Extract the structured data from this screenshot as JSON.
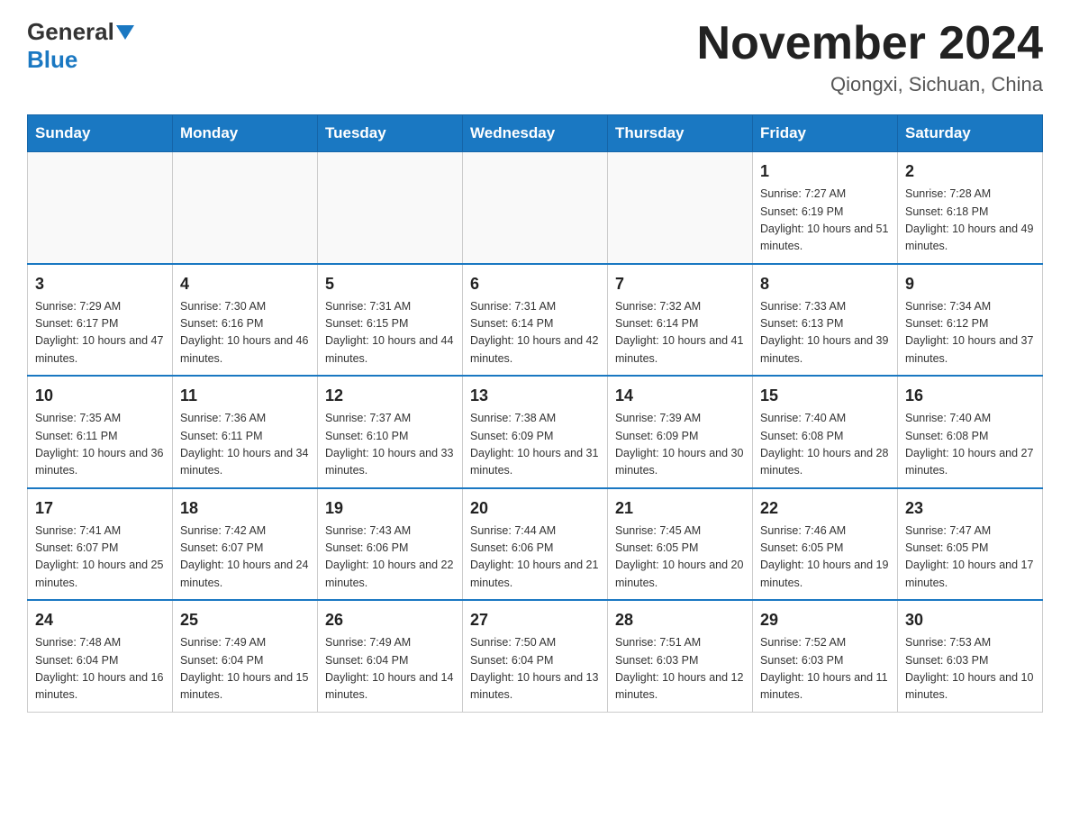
{
  "header": {
    "logo_general": "General",
    "logo_blue": "Blue",
    "month_title": "November 2024",
    "location": "Qiongxi, Sichuan, China"
  },
  "days_of_week": [
    "Sunday",
    "Monday",
    "Tuesday",
    "Wednesday",
    "Thursday",
    "Friday",
    "Saturday"
  ],
  "weeks": [
    [
      {
        "day": "",
        "info": ""
      },
      {
        "day": "",
        "info": ""
      },
      {
        "day": "",
        "info": ""
      },
      {
        "day": "",
        "info": ""
      },
      {
        "day": "",
        "info": ""
      },
      {
        "day": "1",
        "info": "Sunrise: 7:27 AM\nSunset: 6:19 PM\nDaylight: 10 hours and 51 minutes."
      },
      {
        "day": "2",
        "info": "Sunrise: 7:28 AM\nSunset: 6:18 PM\nDaylight: 10 hours and 49 minutes."
      }
    ],
    [
      {
        "day": "3",
        "info": "Sunrise: 7:29 AM\nSunset: 6:17 PM\nDaylight: 10 hours and 47 minutes."
      },
      {
        "day": "4",
        "info": "Sunrise: 7:30 AM\nSunset: 6:16 PM\nDaylight: 10 hours and 46 minutes."
      },
      {
        "day": "5",
        "info": "Sunrise: 7:31 AM\nSunset: 6:15 PM\nDaylight: 10 hours and 44 minutes."
      },
      {
        "day": "6",
        "info": "Sunrise: 7:31 AM\nSunset: 6:14 PM\nDaylight: 10 hours and 42 minutes."
      },
      {
        "day": "7",
        "info": "Sunrise: 7:32 AM\nSunset: 6:14 PM\nDaylight: 10 hours and 41 minutes."
      },
      {
        "day": "8",
        "info": "Sunrise: 7:33 AM\nSunset: 6:13 PM\nDaylight: 10 hours and 39 minutes."
      },
      {
        "day": "9",
        "info": "Sunrise: 7:34 AM\nSunset: 6:12 PM\nDaylight: 10 hours and 37 minutes."
      }
    ],
    [
      {
        "day": "10",
        "info": "Sunrise: 7:35 AM\nSunset: 6:11 PM\nDaylight: 10 hours and 36 minutes."
      },
      {
        "day": "11",
        "info": "Sunrise: 7:36 AM\nSunset: 6:11 PM\nDaylight: 10 hours and 34 minutes."
      },
      {
        "day": "12",
        "info": "Sunrise: 7:37 AM\nSunset: 6:10 PM\nDaylight: 10 hours and 33 minutes."
      },
      {
        "day": "13",
        "info": "Sunrise: 7:38 AM\nSunset: 6:09 PM\nDaylight: 10 hours and 31 minutes."
      },
      {
        "day": "14",
        "info": "Sunrise: 7:39 AM\nSunset: 6:09 PM\nDaylight: 10 hours and 30 minutes."
      },
      {
        "day": "15",
        "info": "Sunrise: 7:40 AM\nSunset: 6:08 PM\nDaylight: 10 hours and 28 minutes."
      },
      {
        "day": "16",
        "info": "Sunrise: 7:40 AM\nSunset: 6:08 PM\nDaylight: 10 hours and 27 minutes."
      }
    ],
    [
      {
        "day": "17",
        "info": "Sunrise: 7:41 AM\nSunset: 6:07 PM\nDaylight: 10 hours and 25 minutes."
      },
      {
        "day": "18",
        "info": "Sunrise: 7:42 AM\nSunset: 6:07 PM\nDaylight: 10 hours and 24 minutes."
      },
      {
        "day": "19",
        "info": "Sunrise: 7:43 AM\nSunset: 6:06 PM\nDaylight: 10 hours and 22 minutes."
      },
      {
        "day": "20",
        "info": "Sunrise: 7:44 AM\nSunset: 6:06 PM\nDaylight: 10 hours and 21 minutes."
      },
      {
        "day": "21",
        "info": "Sunrise: 7:45 AM\nSunset: 6:05 PM\nDaylight: 10 hours and 20 minutes."
      },
      {
        "day": "22",
        "info": "Sunrise: 7:46 AM\nSunset: 6:05 PM\nDaylight: 10 hours and 19 minutes."
      },
      {
        "day": "23",
        "info": "Sunrise: 7:47 AM\nSunset: 6:05 PM\nDaylight: 10 hours and 17 minutes."
      }
    ],
    [
      {
        "day": "24",
        "info": "Sunrise: 7:48 AM\nSunset: 6:04 PM\nDaylight: 10 hours and 16 minutes."
      },
      {
        "day": "25",
        "info": "Sunrise: 7:49 AM\nSunset: 6:04 PM\nDaylight: 10 hours and 15 minutes."
      },
      {
        "day": "26",
        "info": "Sunrise: 7:49 AM\nSunset: 6:04 PM\nDaylight: 10 hours and 14 minutes."
      },
      {
        "day": "27",
        "info": "Sunrise: 7:50 AM\nSunset: 6:04 PM\nDaylight: 10 hours and 13 minutes."
      },
      {
        "day": "28",
        "info": "Sunrise: 7:51 AM\nSunset: 6:03 PM\nDaylight: 10 hours and 12 minutes."
      },
      {
        "day": "29",
        "info": "Sunrise: 7:52 AM\nSunset: 6:03 PM\nDaylight: 10 hours and 11 minutes."
      },
      {
        "day": "30",
        "info": "Sunrise: 7:53 AM\nSunset: 6:03 PM\nDaylight: 10 hours and 10 minutes."
      }
    ]
  ]
}
